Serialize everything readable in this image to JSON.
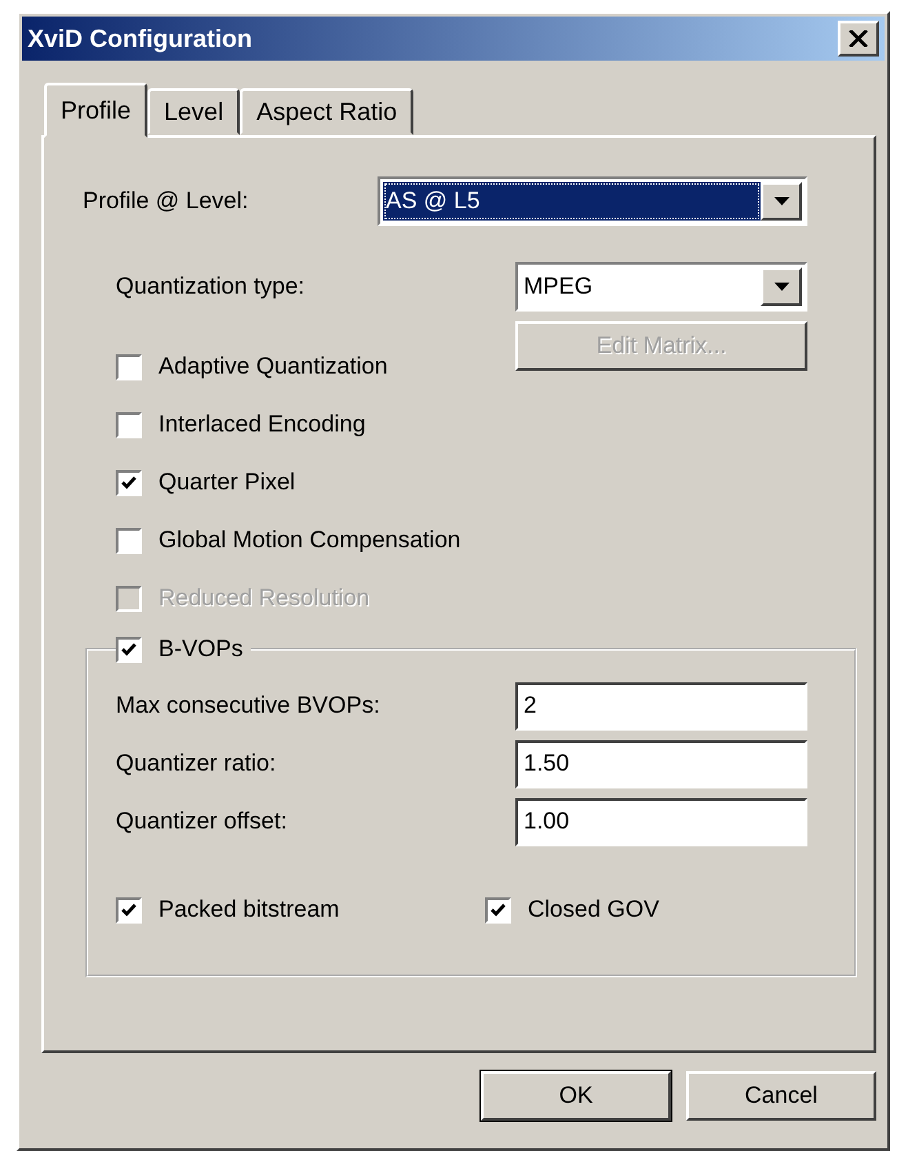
{
  "window": {
    "title": "XviD Configuration"
  },
  "tabs": [
    {
      "label": "Profile",
      "selected": true
    },
    {
      "label": "Level",
      "selected": false
    },
    {
      "label": "Aspect Ratio",
      "selected": false
    }
  ],
  "profile_level": {
    "label": "Profile @ Level:",
    "value": "AS @ L5",
    "highlighted": true
  },
  "quantization": {
    "label": "Quantization type:",
    "value": "MPEG"
  },
  "edit_matrix": {
    "label": "Edit Matrix...",
    "disabled": true
  },
  "options": [
    {
      "label": "Adaptive Quantization",
      "checked": false,
      "disabled": false
    },
    {
      "label": "Interlaced Encoding",
      "checked": false,
      "disabled": false
    },
    {
      "label": "Quarter Pixel",
      "checked": true,
      "disabled": false
    },
    {
      "label": "Global Motion Compensation",
      "checked": false,
      "disabled": false
    },
    {
      "label": "Reduced Resolution",
      "checked": false,
      "disabled": true
    }
  ],
  "bvops": {
    "label": "B-VOPs",
    "checked": true,
    "fields": [
      {
        "label": "Max consecutive BVOPs:",
        "value": "2"
      },
      {
        "label": "Quantizer ratio:",
        "value": "1.50"
      },
      {
        "label": "Quantizer offset:",
        "value": "1.00"
      }
    ],
    "options": [
      {
        "label": "Packed bitstream",
        "checked": true
      },
      {
        "label": "Closed GOV",
        "checked": true
      }
    ]
  },
  "buttons": [
    {
      "label": "OK",
      "default": true
    },
    {
      "label": "Cancel",
      "default": false
    }
  ]
}
